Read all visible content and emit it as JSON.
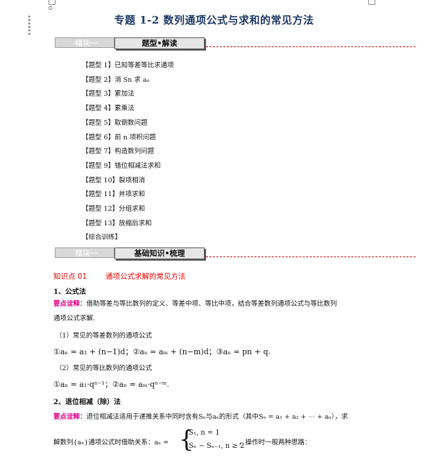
{
  "page": {
    "title": "专题 1-2    数列通项公式与求和的常见方法"
  },
  "module1": {
    "tab": "模块一",
    "label": "题型•解读"
  },
  "types": [
    "【题型 1】已知等差等比求通项",
    "【题型 2】消 Sn 求 aₙ",
    "【题型 3】累加法",
    "【题型 4】累乘法",
    "【题型 5】取倒数问题",
    "【题型 6】前 n 项积问题",
    "【题型 7】构造数列问题",
    "【题型 9】错位相减法求和",
    "【题型 10】裂项相消",
    "【题型 11】并项求和",
    "【题型 12】分组求和",
    "【题型 13】放缩后求和",
    "【综合训练】"
  ],
  "module2": {
    "tab": "模块一",
    "label": "基础知识•梳理"
  },
  "knowledge": {
    "num": "知识点 01",
    "title": "通项公式求解的常见方法"
  },
  "sec1": {
    "heading": "1、公式法",
    "tip_label": "要点诠释：",
    "tip_text": "借助等差与等比数列的定义、等差中项、等比中项，结合等差数列通项公式与等比数列",
    "tip_text2": "通项公式求解.",
    "sub1": "（1）常见的等差数列的通项公式",
    "formula1": "①aₙ = a₁ + (n−1)d；②aₙ = aₘ + (n−m)d；③aₙ = pn + q.",
    "sub2": "（2）常见的等比数列的通项公式",
    "formula2": "①aₙ = a₁·qⁿ⁻¹；②aₙ = aₘ·qⁿ⁻ᵐ."
  },
  "sec2": {
    "heading": "2、退位相减（除）法",
    "tip_label": "要点诠释：",
    "tip_text": "退位相减法适用于递推关系中同时含有Sₙ与aₙ的形式（其中Sₙ = a₁ + a₂ + ⋯ + aₙ），求",
    "line2_pre": "解数列{aₙ}通项公式时借助关系：aₙ =",
    "case1": "S₁, n = 1",
    "case2": "Sₙ − Sₙ₋₁, n ≥ 2",
    "line2_post": "，操作时一般两种思路："
  }
}
